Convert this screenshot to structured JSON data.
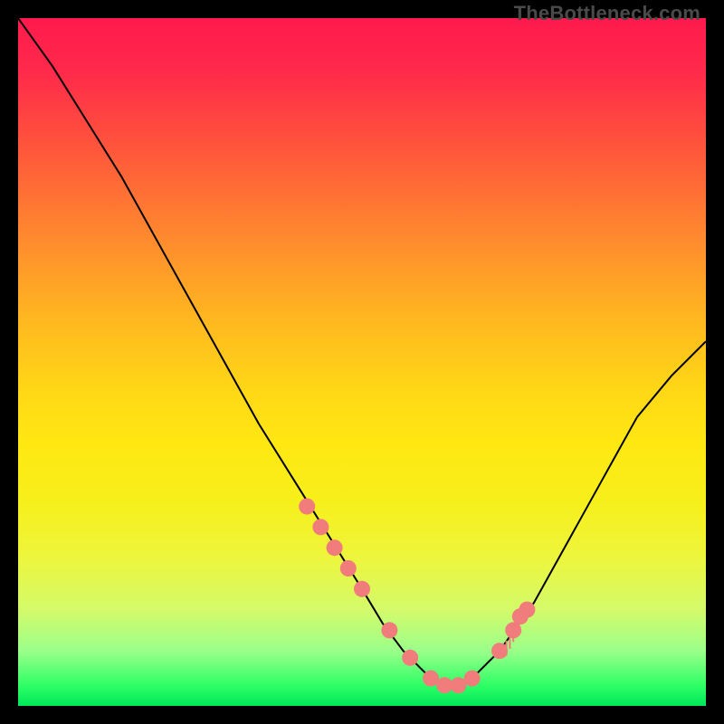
{
  "watermark": "TheBottleneck.com",
  "chart_data": {
    "type": "line",
    "title": "",
    "xlabel": "",
    "ylabel": "",
    "xlim": [
      0,
      100
    ],
    "ylim": [
      0,
      100
    ],
    "series": [
      {
        "name": "bottleneck-curve",
        "x": [
          0,
          5,
          10,
          15,
          20,
          25,
          30,
          35,
          40,
          45,
          50,
          53,
          56,
          58,
          60,
          62,
          64,
          66,
          70,
          75,
          80,
          85,
          90,
          95,
          100
        ],
        "y": [
          100,
          93,
          85,
          77,
          68,
          59,
          50,
          41,
          33,
          25,
          17,
          12,
          8,
          6,
          4,
          3,
          3,
          4,
          8,
          15,
          24,
          33,
          42,
          48,
          53
        ]
      }
    ],
    "markers": {
      "name": "highlighted-points",
      "x": [
        42,
        44,
        46,
        48,
        50,
        54,
        57,
        60,
        62,
        64,
        66,
        70,
        72,
        73,
        74
      ],
      "y": [
        29,
        26,
        23,
        20,
        17,
        11,
        7,
        4,
        3,
        3,
        4,
        8,
        11,
        13,
        14
      ]
    },
    "ticks": {
      "x": [
        71,
        71.5,
        72
      ],
      "y_top": [
        9.5,
        10.5,
        11.5
      ],
      "height": 2.2
    },
    "gradient_stops": [
      {
        "pos": 0,
        "color": "#ff1a4d"
      },
      {
        "pos": 50,
        "color": "#ffd716"
      },
      {
        "pos": 100,
        "color": "#00e85a"
      }
    ]
  }
}
